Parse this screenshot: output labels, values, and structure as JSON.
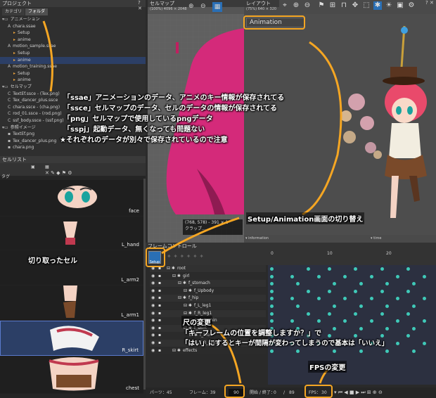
{
  "project": {
    "title": "プロジェクト",
    "tabs": [
      "カテゴリ",
      "フォルダ"
    ],
    "tree": [
      {
        "label": "アニメーション",
        "indent": 0,
        "icon": "folder"
      },
      {
        "label": "chara.ssae",
        "indent": 1,
        "icon": "A"
      },
      {
        "label": "Setup",
        "indent": 2,
        "icon": "clip"
      },
      {
        "label": "anime",
        "indent": 2,
        "icon": "clip"
      },
      {
        "label": "motion_sample.ssae",
        "indent": 1,
        "icon": "A"
      },
      {
        "label": "Setup",
        "indent": 2,
        "icon": "clip"
      },
      {
        "label": "anime",
        "indent": 2,
        "icon": "clip",
        "selected": true
      },
      {
        "label": "motion_training.ssae",
        "indent": 1,
        "icon": "A"
      },
      {
        "label": "Setup",
        "indent": 2,
        "icon": "clip"
      },
      {
        "label": "anime",
        "indent": 2,
        "icon": "clip"
      },
      {
        "label": "セルマップ",
        "indent": 0,
        "icon": "folder"
      },
      {
        "label": "TextEf.ssce - (Tex.png)",
        "indent": 1,
        "icon": "C"
      },
      {
        "label": "Tex_dancer_plus.ssce",
        "indent": 1,
        "icon": "C"
      },
      {
        "label": "chara.ssce - (cha.png)",
        "indent": 1,
        "icon": "C"
      },
      {
        "label": "rod_01.ssce - (rod.png)",
        "indent": 1,
        "icon": "C"
      },
      {
        "label": "ssf_body.ssce - (ssf.png)",
        "indent": 1,
        "icon": "C"
      },
      {
        "label": "参照イメージ",
        "indent": 0,
        "icon": "folder"
      },
      {
        "label": "TextEf.png",
        "indent": 1,
        "icon": "img"
      },
      {
        "label": "Tex_dancer_plus.png",
        "indent": 1,
        "icon": "img"
      },
      {
        "label": "chara.png",
        "indent": 1,
        "icon": "img"
      }
    ]
  },
  "cellmap": {
    "title": "セルマップ",
    "size": "(100%) 4096 × 2048",
    "coords": "(768, 578) - 391 × 1",
    "sub": "クラップ..."
  },
  "layout": {
    "title": "レイアウト",
    "size": "(75%) 640 × 320",
    "mode_label": "Animation",
    "setup_label": "Setup",
    "info": "▾ information",
    "time": "▾ time"
  },
  "celllist": {
    "title": "セルリスト",
    "tag_label": "タグ",
    "cells": [
      "face",
      "L_hand",
      "L_arm2",
      "L_arm1",
      "R_skirt",
      "chest"
    ]
  },
  "frame_control": {
    "title": "フレームコントロール",
    "setup_label": "Setup",
    "ruler": [
      "0",
      "10",
      "20"
    ]
  },
  "tracks": [
    {
      "name": "root",
      "indent": 0
    },
    {
      "name": "girl",
      "indent": 1
    },
    {
      "name": "f_stomach",
      "indent": 2
    },
    {
      "name": "f_Upbody",
      "indent": 3
    },
    {
      "name": "f_hip",
      "indent": 2
    },
    {
      "name": "f_L_leg1",
      "indent": 3
    },
    {
      "name": "f_R_leg1",
      "indent": 3
    },
    {
      "name": "f_R_shin",
      "indent": 4
    },
    {
      "name": "f_skirt",
      "indent": 3
    },
    {
      "name": "f_foo",
      "indent": 4
    },
    {
      "name": "f_R_skirt",
      "indent": 4
    },
    {
      "name": "effects",
      "indent": 1
    }
  ],
  "statusbar": {
    "parts_label": "パーツ：45",
    "frame_label": "フレーム：39",
    "frame_value": "90",
    "range_label": "開始 / 終了：",
    "range_start": "0",
    "range_sep": "/",
    "range_end": "89",
    "fps_label": "FPS：",
    "fps_value": "30"
  },
  "annotations": {
    "line1": "「ssae」アニメーションのデータ、アニメのキー情報が保存されてる",
    "line2": "「ssce」セルマップのデータ、セルのデータの情報が保存されてる",
    "line3": "「png」セルマップで使用しているpngデータ",
    "line4": "「sspj」起動データ、無くなっても問題ない",
    "line5": "★それぞれのデータが別々で保存されているので注意",
    "setup_switch": "Setup/Animation画面の切り替え",
    "cut_cells": "切り取ったセル",
    "scale_change": "尺の変更",
    "dialog1": "「キーフレームの位置を調整しますか？」で",
    "dialog2": "「はい」にするとキーが間隔が変わってしまうので基本は「いいえ」",
    "fps_change": "FPSの変更"
  },
  "colors": {
    "accent": "#f5a623",
    "teal": "#3fc9b8",
    "select": "#2c3f66",
    "magenta": "#d42a7a"
  }
}
